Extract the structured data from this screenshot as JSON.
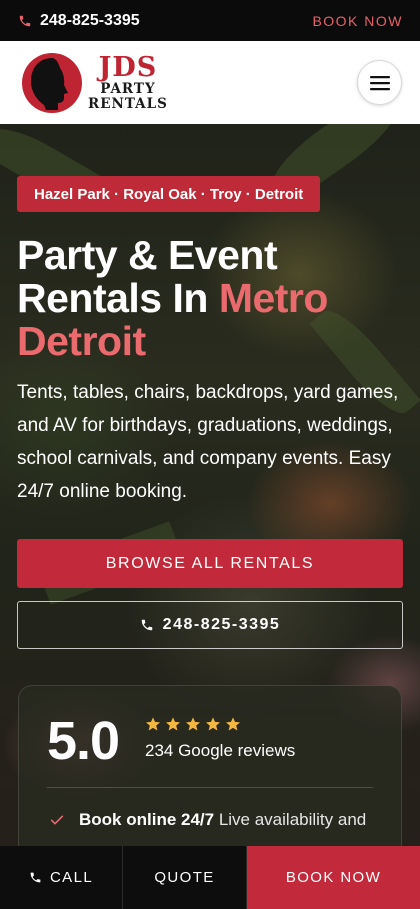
{
  "topbar": {
    "phone": "248-825-3395",
    "book_now": "BOOK NOW"
  },
  "header": {
    "logo": {
      "jds": "JDS",
      "line1": "PARTY",
      "line2": "RENTALS"
    }
  },
  "hero": {
    "tag": "Hazel Park · Royal Oak · Troy · Detroit",
    "title_line1": "Party & Event",
    "title_line2a": "Rentals In ",
    "title_line2b": "Metro",
    "title_line3": "Detroit",
    "description": "Tents, tables, chairs, backdrops, yard games, and AV for birthdays, graduations, weddings, school carnivals, and company events. Easy 24/7 online booking.",
    "browse_button": "BROWSE ALL RENTALS",
    "phone_button": "248-825-3395"
  },
  "rating_card": {
    "score": "5.0",
    "stars": 5,
    "reviews": "234 Google reviews",
    "feature_bold": "Book online 24/7",
    "feature_rest": " Live availability and"
  },
  "bottom_bar": {
    "call": "CALL",
    "quote": "QUOTE",
    "book_now": "BOOK NOW"
  },
  "colors": {
    "brand_red": "#c2293a",
    "accent_pink": "#ea6a6e",
    "star": "#f4b740"
  }
}
